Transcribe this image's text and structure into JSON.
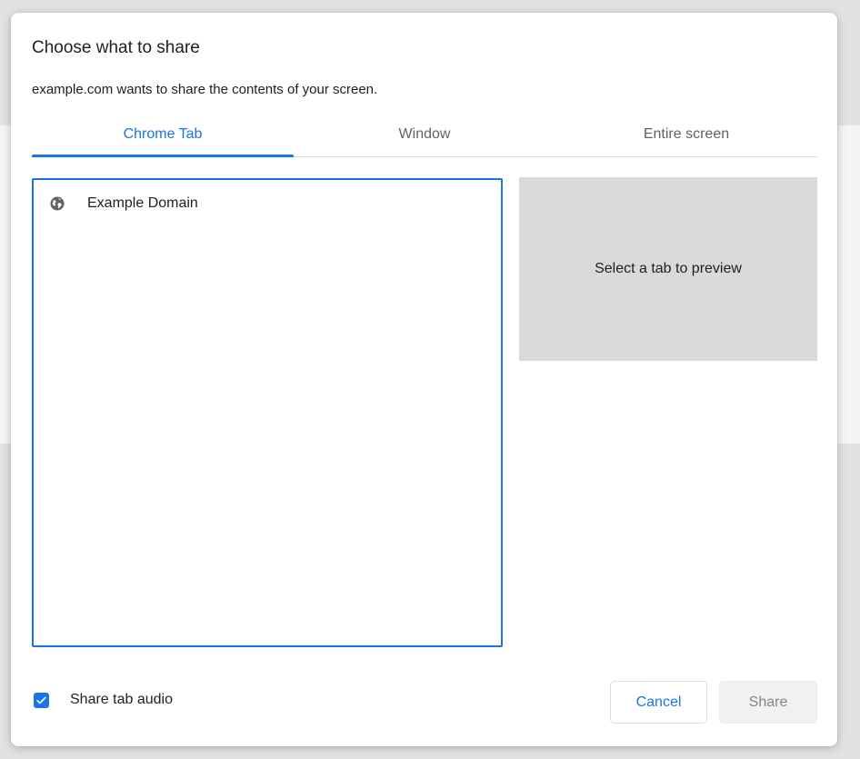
{
  "dialog": {
    "title": "Choose what to share",
    "subtitle": "example.com wants to share the contents of your screen."
  },
  "tabs": [
    {
      "label": "Chrome Tab",
      "active": true
    },
    {
      "label": "Window",
      "active": false
    },
    {
      "label": "Entire screen",
      "active": false
    }
  ],
  "tab_list": {
    "items": [
      {
        "title": "Example Domain",
        "icon": "globe-icon"
      }
    ]
  },
  "preview": {
    "placeholder": "Select a tab to preview"
  },
  "audio": {
    "label": "Share tab audio",
    "checked": true
  },
  "buttons": {
    "cancel_label": "Cancel",
    "share_label": "Share"
  },
  "colors": {
    "accent": "#1a73e8",
    "preview_bg": "#dadadd",
    "disabled_bg": "#f1f1f2"
  }
}
